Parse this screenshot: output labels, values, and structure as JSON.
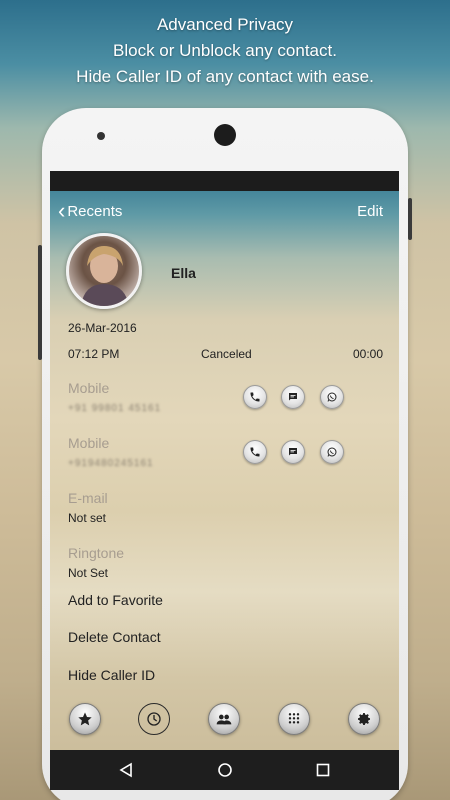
{
  "promo": {
    "title": "Advanced Privacy",
    "line1": "Block or Unblock any contact.",
    "line2": "Hide Caller ID of any contact with ease."
  },
  "topbar": {
    "back_label": "Recents",
    "edit_label": "Edit"
  },
  "contact": {
    "name": "Ella",
    "date": "26-Mar-2016",
    "call": {
      "time": "07:12 PM",
      "status": "Canceled",
      "duration": "00:00"
    }
  },
  "fields": [
    {
      "label": "Mobile",
      "value": "+91 99801 45161"
    },
    {
      "label": "Mobile",
      "value": "+919480245161"
    },
    {
      "label": "E-mail",
      "value": "Not set"
    },
    {
      "label": "Ringtone",
      "value": "Not Set"
    }
  ],
  "actions": {
    "call_icon": "phone-icon",
    "message_icon": "message-icon",
    "whatsapp_icon": "whatsapp-icon"
  },
  "menu": {
    "favorite": "Add to Favorite",
    "delete": "Delete Contact",
    "hide_caller": "Hide Caller ID"
  },
  "tabs": [
    "star-icon",
    "clock-icon",
    "contacts-icon",
    "dialpad-icon",
    "gear-icon"
  ],
  "navbar": [
    "back-triangle-icon",
    "home-circle-icon",
    "recents-square-icon"
  ]
}
